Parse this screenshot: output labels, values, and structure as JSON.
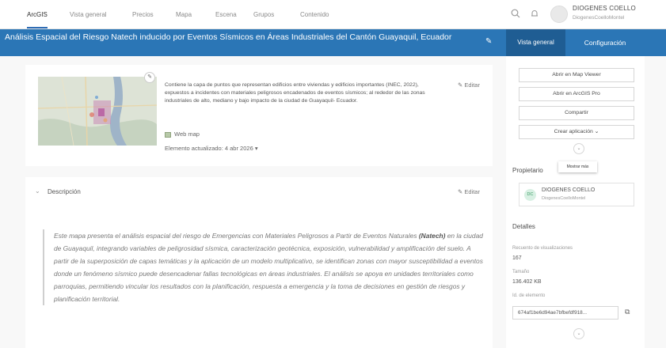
{
  "topnav": {
    "tabs": [
      {
        "label": "ArcGIS",
        "active": true
      },
      {
        "label": "Vista general",
        "active": false
      },
      {
        "label": "Precios",
        "active": false
      },
      {
        "label": "Mapa",
        "active": false
      },
      {
        "label": "Escena",
        "active": false
      },
      {
        "label": "Grupos",
        "active": false
      },
      {
        "label": "Contenido",
        "active": false
      }
    ],
    "icons": [
      "search-icon",
      "notifications-icon"
    ],
    "user": {
      "name": "DIOGENES COELLO",
      "handle": "DiogenesCoelloMontel"
    }
  },
  "titlebar": {
    "title": "Análisis Espacial del Riesgo Natech inducido por Eventos Sísmicos en Áreas Industriales del Cantón Guayaquil, Ecuador",
    "tab_overview": "Vista general",
    "tab_settings": "Configuración",
    "accent_color": "#2b76b6"
  },
  "summary": {
    "text": "Contiene la capa de puntos que representan edificios entre viviendas y edificios importantes (INEC, 2022), expuestos a incidentes con materiales peligrosos encadenados de eventos sísmicos; al rededor de las zonas industriales de alto, mediano y bajo impacto de la ciudad de Guayaquil- Ecuador.",
    "type": "Web map",
    "updated": "Elemento actualizado: 4 abr 2026 ▾",
    "edit_label": "Editar"
  },
  "description": {
    "header": "Descripción",
    "edit_label": "Editar",
    "body_before": "Este mapa presenta el análisis espacial del riesgo de Emergencias con Materiales Peligrosos a Partir de Eventos Naturales ",
    "body_bold": "(Natech)",
    "body_after": " en la ciudad de Guayaquil, integrando variables de peligrosidad sísmica, caracterización geotécnica, exposición, vulnerabilidad y amplificación del suelo. A partir de la superposición de capas temáticas y la aplicación de un modelo multiplicativo, se identifican zonas con mayor susceptibilidad a eventos donde un fenómeno sísmico puede desencadenar fallas tecnológicas en áreas industriales. El análisis se apoya en unidades territoriales como parroquias, permitiendo vincular los resultados con la planificación, respuesta a emergencia y la toma de decisiones en gestión de riesgos y planificación territorial."
  },
  "sidebar": {
    "buttons": [
      "Abrir en Map Viewer",
      "Abrir en ArcGIS Pro",
      "Compartir",
      "Crear aplicación  ⌄"
    ],
    "tooltip": "Mostrar más",
    "owner_label": "Propietario",
    "owner": {
      "initials": "DC",
      "name": "DIOGENES COELLO",
      "handle": "DiogenesCoelloMontel"
    },
    "details_label": "Detalles",
    "views_label": "Recuento de visualizaciones",
    "views_value": "167",
    "size_label": "Tamaño",
    "size_value": "136.402 KB",
    "id_label": "Id. de elemento",
    "id_value": "674af1be6d94ae7bfbefdf918..."
  }
}
